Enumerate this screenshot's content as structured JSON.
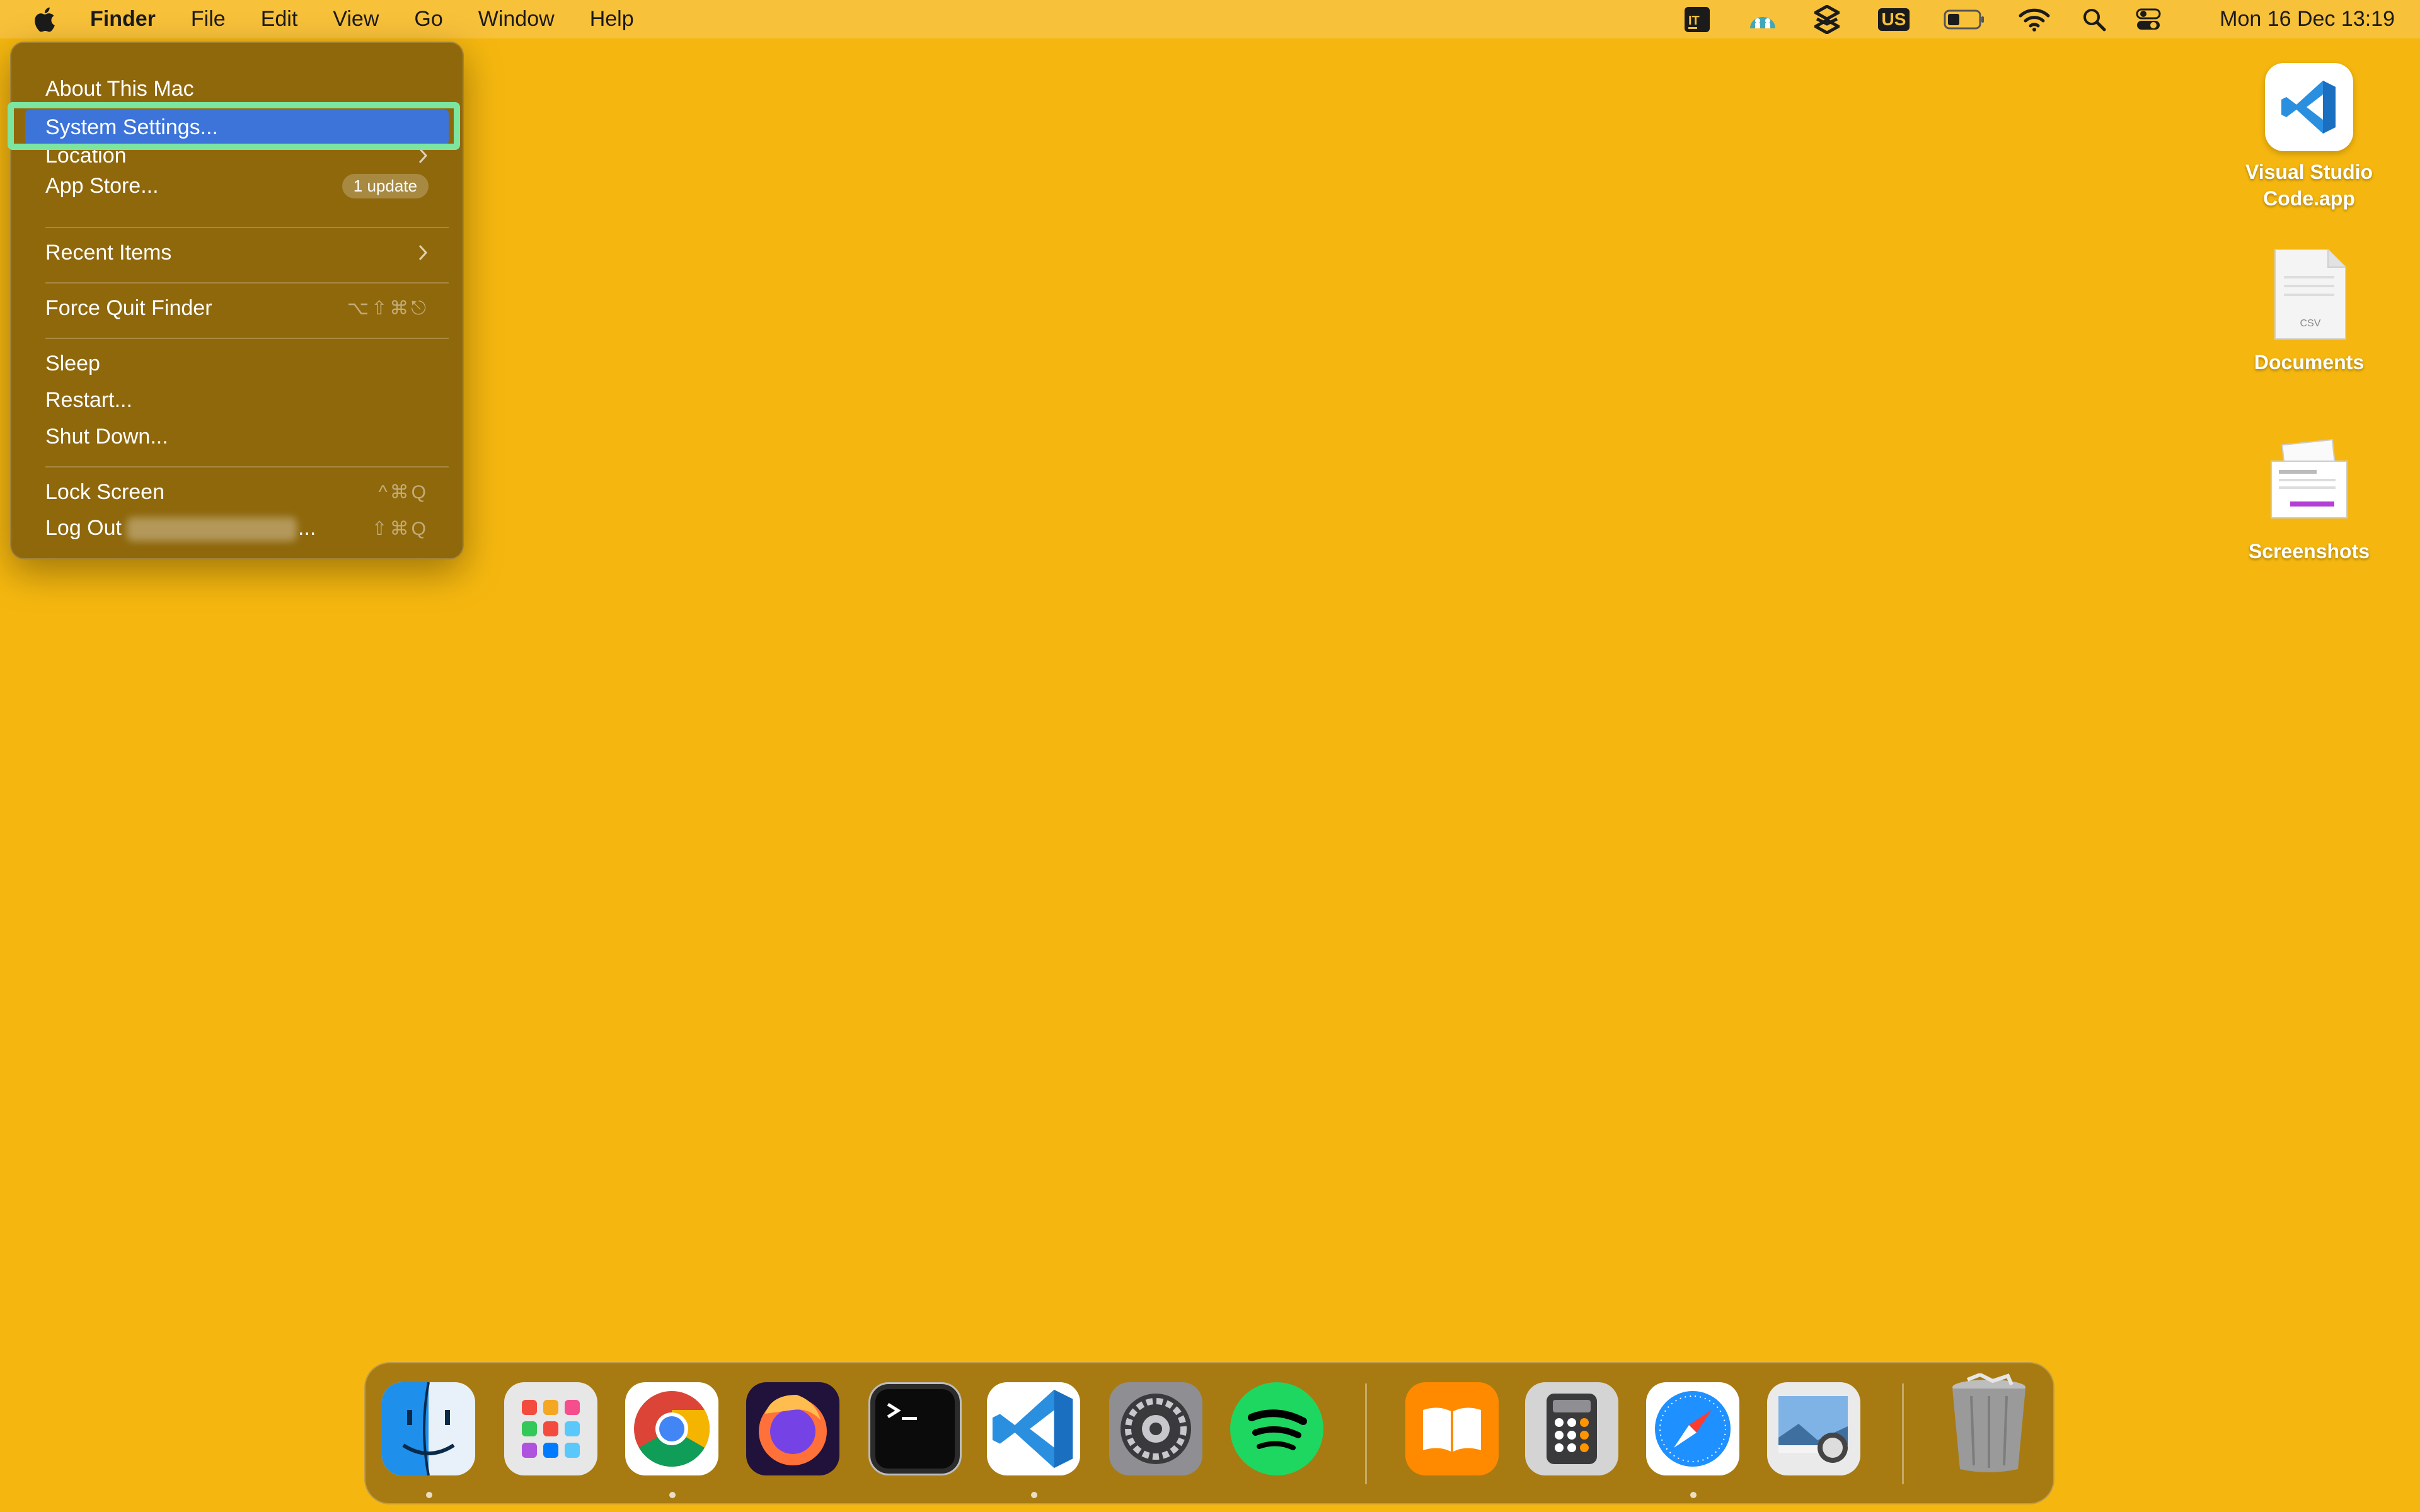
{
  "menubar": {
    "apple_icon": "apple-logo-icon",
    "app_name": "Finder",
    "menus": [
      "File",
      "Edit",
      "View",
      "Go",
      "Window",
      "Help"
    ],
    "status_icons": [
      "intellij-toolbox-icon",
      "cloud-people-icon",
      "stacks-icon",
      "input-source-icon",
      "battery-icon",
      "wifi-icon",
      "spotlight-search-icon",
      "control-center-icon"
    ],
    "input_source": "US",
    "clock": "Mon 16 Dec  13:19"
  },
  "apple_menu": {
    "items": {
      "about": "About This Mac",
      "system_settings": "System Settings...",
      "location": "Location",
      "app_store": "App Store...",
      "app_store_badge": "1 update",
      "recent_items": "Recent Items",
      "force_quit": "Force Quit Finder",
      "force_quit_shortcut": "⌥⇧⌘⎋",
      "sleep": "Sleep",
      "restart": "Restart...",
      "shut_down": "Shut Down...",
      "lock_screen": "Lock Screen",
      "lock_screen_shortcut": "^⌘Q",
      "log_out": "Log Out",
      "log_out_suffix": "...",
      "log_out_shortcut": "⇧⌘Q"
    },
    "highlighted_item": "System Settings...",
    "highlight_color": "#3C74DA",
    "focus_ring_color": "#7CE6A0"
  },
  "desktop": {
    "background_color": "#F5B70F",
    "icons": [
      {
        "label": "Visual Studio Code.app",
        "line1": "Visual Studio",
        "line2": "Code.app",
        "icon": "vscode-icon"
      },
      {
        "label": "Documents",
        "icon": "csv-document-icon"
      },
      {
        "label": "Screenshots",
        "icon": "screenshots-icon"
      }
    ]
  },
  "dock": {
    "apps": [
      {
        "name": "Finder",
        "icon": "finder-icon",
        "running": true
      },
      {
        "name": "Launchpad",
        "icon": "launchpad-icon",
        "running": false
      },
      {
        "name": "Google Chrome",
        "icon": "chrome-icon",
        "running": true
      },
      {
        "name": "Firefox",
        "icon": "firefox-icon",
        "running": false
      },
      {
        "name": "Terminal",
        "icon": "terminal-icon",
        "running": false
      },
      {
        "name": "Visual Studio Code",
        "icon": "vscode-icon",
        "running": true
      },
      {
        "name": "System Settings",
        "icon": "system-settings-icon",
        "running": false
      },
      {
        "name": "Spotify",
        "icon": "spotify-icon",
        "running": false
      },
      {
        "name": "Books",
        "icon": "books-icon",
        "running": false
      },
      {
        "name": "Calculator",
        "icon": "calculator-icon",
        "running": false
      },
      {
        "name": "Safari",
        "icon": "safari-icon",
        "running": true
      },
      {
        "name": "Preview",
        "icon": "preview-icon",
        "running": false
      },
      {
        "name": "Trash",
        "icon": "trash-icon",
        "running": false
      }
    ]
  }
}
